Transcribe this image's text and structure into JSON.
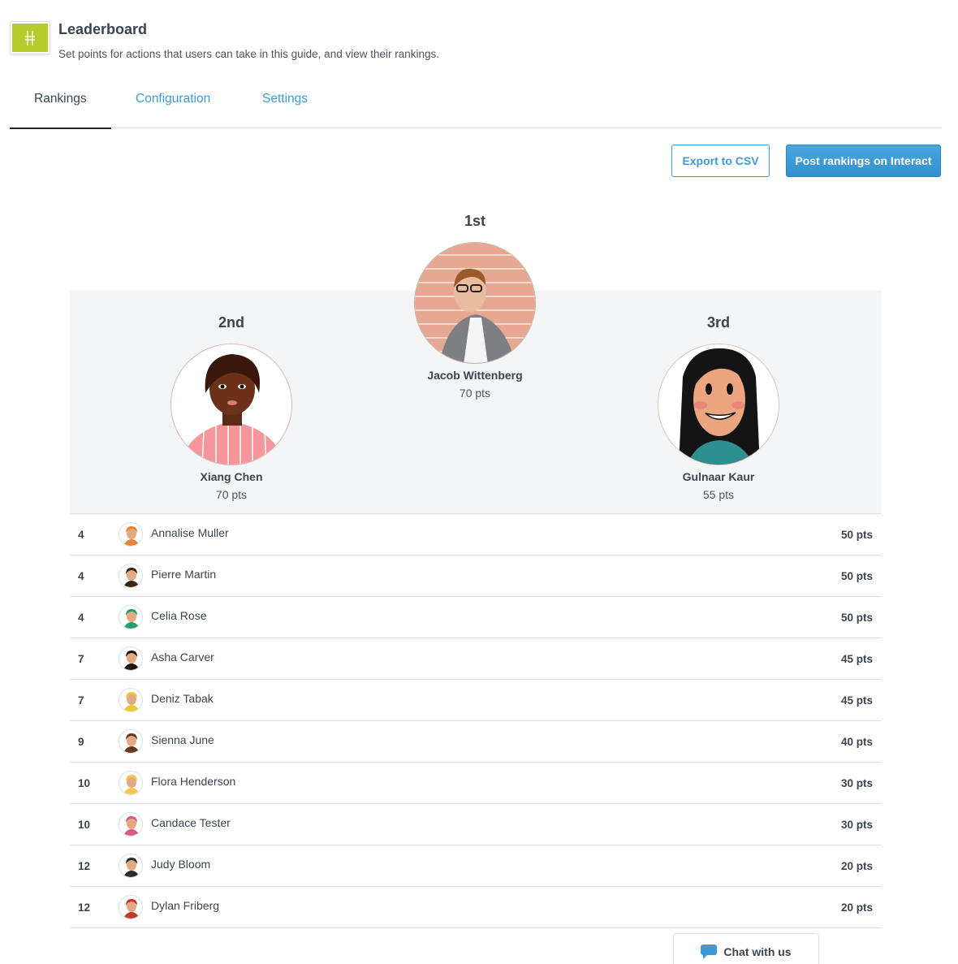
{
  "header": {
    "app_icon": "leaderboard-app-icon",
    "title": "Leaderboard",
    "subtitle": "Set points for actions that users can take in this guide, and view their rankings."
  },
  "tabs": [
    {
      "label": "Rankings",
      "active": true
    },
    {
      "label": "Configuration",
      "active": false
    },
    {
      "label": "Settings",
      "active": false
    }
  ],
  "actions": {
    "export_label": "Export to CSV",
    "post_label": "Post rankings on Interact"
  },
  "podium": {
    "first": {
      "place": "1st",
      "name": "Jacob Wittenberg",
      "points": "70 pts"
    },
    "second": {
      "place": "2nd",
      "name": "Xiang Chen",
      "points": "70 pts"
    },
    "third": {
      "place": "3rd",
      "name": "Gulnaar Kaur",
      "points": "55 pts"
    }
  },
  "rankings": [
    {
      "rank": "4",
      "name": "Annalise Muller",
      "points": "50 pts",
      "avatar_color": "#e8833a"
    },
    {
      "rank": "4",
      "name": "Pierre Martin",
      "points": "50 pts",
      "avatar_color": "#3b2418"
    },
    {
      "rank": "4",
      "name": "Celia Rose",
      "points": "50 pts",
      "avatar_color": "#2a9d6a"
    },
    {
      "rank": "7",
      "name": "Asha Carver",
      "points": "45 pts",
      "avatar_color": "#1e1208"
    },
    {
      "rank": "7",
      "name": "Deniz Tabak",
      "points": "45 pts",
      "avatar_color": "#e8c93a"
    },
    {
      "rank": "9",
      "name": "Sienna June",
      "points": "40 pts",
      "avatar_color": "#6a3a1c"
    },
    {
      "rank": "10",
      "name": "Flora Henderson",
      "points": "30 pts",
      "avatar_color": "#f2c94c"
    },
    {
      "rank": "10",
      "name": "Candace Tester",
      "points": "30 pts",
      "avatar_color": "#d9588a"
    },
    {
      "rank": "12",
      "name": "Judy Bloom",
      "points": "20 pts",
      "avatar_color": "#2b2b2b"
    },
    {
      "rank": "12",
      "name": "Dylan Friberg",
      "points": "20 pts",
      "avatar_color": "#c0392b"
    }
  ],
  "chat": {
    "icon": "chat-bubble-icon",
    "label": "Chat with us"
  }
}
